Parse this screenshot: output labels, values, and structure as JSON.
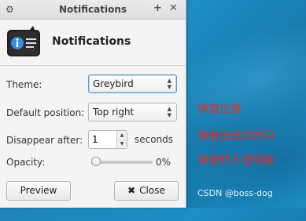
{
  "window": {
    "title": "Notifications",
    "header_title": "Notifications",
    "app_icon": "notification-info-icon"
  },
  "titlebar": {
    "menu_icon": "gear-icon",
    "plus_label": "+",
    "close_label": "✕"
  },
  "settings": {
    "theme": {
      "label": "Theme:",
      "value": "Greybird"
    },
    "position": {
      "label": "Default position:",
      "value": "Top right"
    },
    "disappear": {
      "label": "Disappear after:",
      "value": "1",
      "unit": "seconds"
    },
    "opacity": {
      "label": "Opacity:",
      "value_text": "0%",
      "value": 0
    }
  },
  "buttons": {
    "preview_label": "Preview",
    "close_label": "Close",
    "close_icon": "close-x-icon"
  },
  "annotations": {
    "line1": "弹窗位置",
    "line2": "弹窗出现的时间",
    "line3": "弹窗的不透明度",
    "color": "#d9302c"
  },
  "watermark": "CSDN @boss-dog",
  "colors": {
    "accent": "#5a9bd3",
    "desktop": "#1b8ec4"
  }
}
